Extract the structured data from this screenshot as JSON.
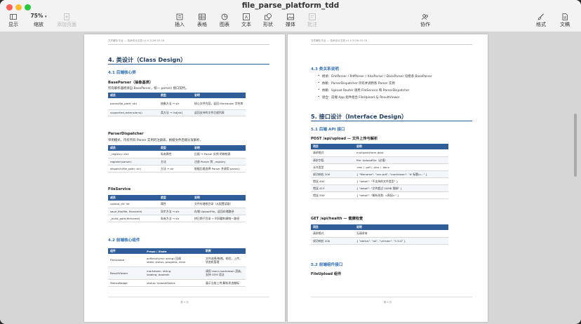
{
  "window": {
    "title": "file_parse_platform_tdd",
    "traffic_lights": {
      "close": "#ff5f57",
      "minimize": "#febc2e",
      "zoom": "#28c840"
    }
  },
  "toolbar": {
    "view": "显示",
    "zoom_value": "75%",
    "zoom": "缩放",
    "add_page": "添加页面",
    "insert": "插入",
    "table": "表格",
    "chart": "图表",
    "text": "文本",
    "shape": "形状",
    "media": "媒体",
    "comment": "批注",
    "collaborate": "协作",
    "format": "格式",
    "document": "文稿"
  },
  "page_left": {
    "header": "文件解析平台 — 技术设计文档   v1.0   2026-03-18",
    "h2": "4. 类设计（Class Design）",
    "s41": "4.1 后端核心类",
    "base_title": "BaseParser（抽象基类）",
    "base_desc": "所有解析器继承自 BaseParser，统一 parse() 接口契约。",
    "base_cols": [
      "成员",
      "类型",
      "说明"
    ],
    "base_rows": [
      [
        "parse(file_path: str)",
        "抽象方法 → str",
        "核心文件内容，返回 Markdown 字符串"
      ],
      [
        "supported_extensions()",
        "类方法 → list[str]",
        "返回支持的文件后缀列表"
      ]
    ],
    "disp_title": "ParserDispatcher",
    "disp_desc": "单例模式，持有所有 Parser 实例的注册表，根据文件后缀分发解析。",
    "disp_cols": [
      "成员",
      "类型",
      "说明"
    ],
    "disp_rows": [
      [
        "_registry: dict",
        "私有属性",
        "后缀 → Parser 实例 的映射表"
      ],
      [
        "register(parser)",
        "方法",
        "注册 Parser 到 _registry"
      ],
      [
        "dispatch(file_path: str)",
        "方法 → str",
        "根据后缀选择 Parser 并调用 parse()"
      ]
    ],
    "fs_title": "FileService",
    "fs_cols": [
      "成员",
      "类型",
      "说明"
    ],
    "fs_rows": [
      [
        "upload_dir: str",
        "属性",
        "文件存储根目录（从配置读取）"
      ],
      [
        "save_file(file, filename)",
        "异步方法 → str",
        "存储 UploadFile，返回存储路径"
      ],
      [
        "_build_path(filename)",
        "私有方法 → str",
        "拼日期子目录 + 时间戳构建唯一路径"
      ]
    ],
    "s42": "4.2 前端核心组件",
    "fe_cols": [
      "组件",
      "Props / State",
      "职责"
    ],
    "fe_rows": [
      [
        "FileUpload",
        "onResult(md: string) 回调\nstate: status, progress, error",
        "文件选择/拖拽，校验，上传，状态机管理"
      ],
      [
        "ResultViewer",
        "markdown: string\nloading: boolean",
        "调用 react-markdown 渲染，支持 GFM 语法"
      ],
      [
        "StatusBadge",
        "status: UploadStatus",
        "展示当前上传/解析状态徽标"
      ]
    ],
    "footer": "第 5 页"
  },
  "page_right": {
    "header": "文件解析平台 — 技术设计文档   v1.0   2026-03-18",
    "s43": "4.3 类关系说明",
    "rel": [
      "继承：EmlParser / PdfParser / XlsxParser / DocxParser 均继承 BaseParser",
      "依赖：ParserDispatcher 持有并调用各 Parser 实例",
      "依赖：Upload Router 调用 FileService 和 ParserDispatcher",
      "组合：前端 App 组件组合 FileUpload 与 ResultViewer"
    ],
    "h2": "5. 接口设计（Interface Design）",
    "s51": "5.1 后端 API 接口",
    "post_title": "POST /api/upload — 文件上传与解析",
    "post_cols": [
      "项目",
      "说明"
    ],
    "post_rows": [
      [
        "请求格式",
        "multipart/form-data"
      ],
      [
        "请求字段",
        "file: UploadFile（必填）"
      ],
      [
        "允许类型",
        ".eml / .pdf / .xlsx / .docx"
      ],
      [
        "成功响应 200",
        "{ \"filename\": \"xxx.pdf\", \"markdown\": \"# 标题\\n...\" }"
      ],
      [
        "错误 400",
        "{ \"detail\": \"不支持的文件类型\" }"
      ],
      [
        "错误 413",
        "{ \"detail\": \"文件超过 20MB 限制\" }"
      ],
      [
        "错误 500",
        "{ \"detail\": \"解析失败: <原因>\" }"
      ]
    ],
    "get_title": "GET /api/health — 健康检查",
    "get_cols": [
      "项目",
      "说明"
    ],
    "get_rows": [
      [
        "请求格式",
        "无请求体"
      ],
      [
        "成功响应 200",
        "{ \"status\": \"ok\", \"version\": \"1.0.0\" }"
      ]
    ],
    "s52": "5.2 前端组件接口",
    "fu_title": "FileUpload 组件",
    "footer": "第 6 页"
  },
  "colors": {
    "accent": "#2f5d98",
    "heading": "#1f3b60",
    "subheading": "#2f6fb5"
  }
}
